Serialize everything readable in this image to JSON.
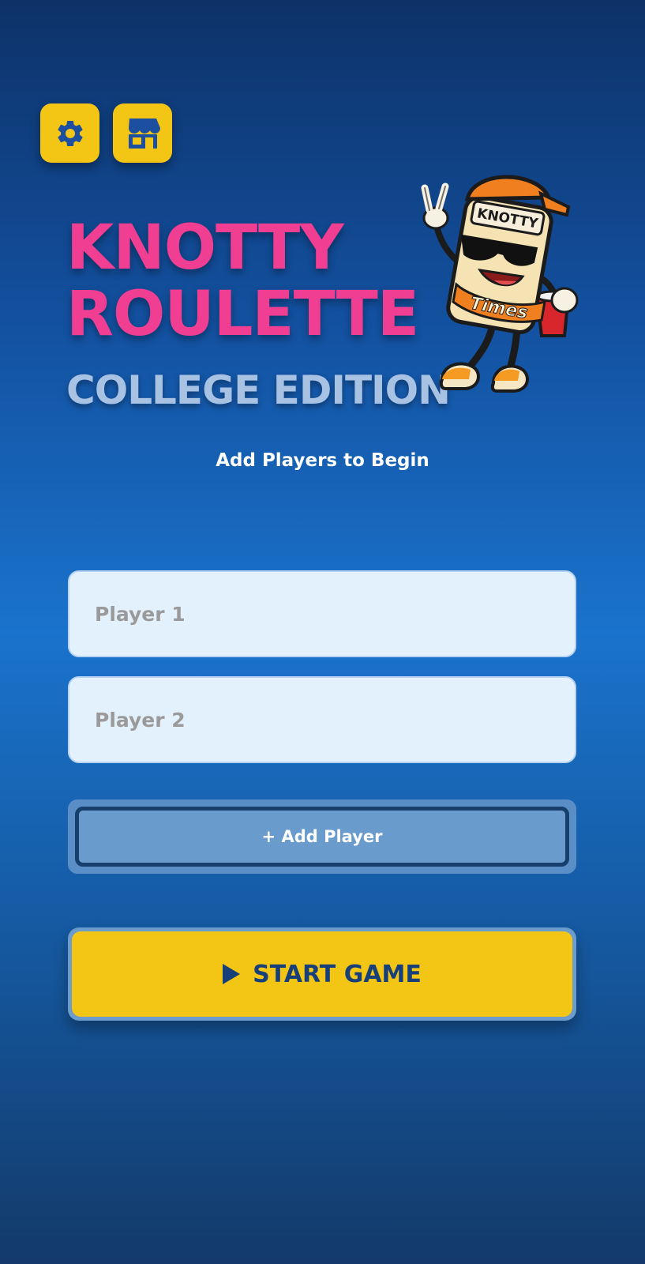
{
  "header": {
    "settings_icon": "gear-icon",
    "shop_icon": "store-icon"
  },
  "title": {
    "line1": "KNOTTY",
    "line2": "ROULETTE",
    "subtitle": "COLLEGE EDITION"
  },
  "mascot": {
    "cap_text": "KNOTTY",
    "can_text": "Times"
  },
  "prompt": "Add Players to Begin",
  "players": [
    {
      "placeholder": "Player 1",
      "value": ""
    },
    {
      "placeholder": "Player 2",
      "value": ""
    }
  ],
  "actions": {
    "add_player_label": "+ Add Player",
    "start_label": "START GAME"
  },
  "colors": {
    "accent_yellow": "#f3c515",
    "title_pink": "#f03e93",
    "subtitle_blue": "#a8c2e4",
    "dark_blue": "#17407a"
  }
}
